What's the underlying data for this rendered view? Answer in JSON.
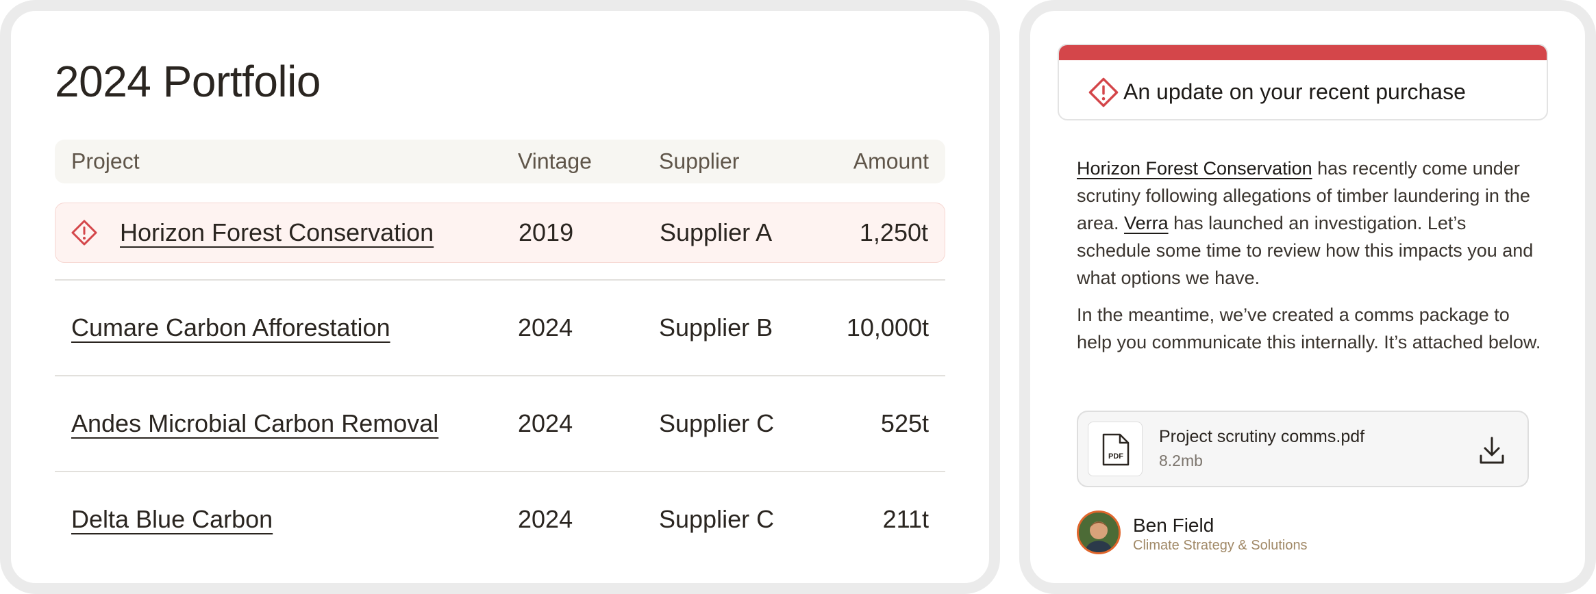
{
  "portfolio": {
    "title": "2024 Portfolio",
    "columns": {
      "project": "Project",
      "vintage": "Vintage",
      "supplier": "Supplier",
      "amount": "Amount"
    },
    "rows": [
      {
        "project": "Horizon Forest Conservation",
        "vintage": "2019",
        "supplier": "Supplier A",
        "amount": "1,250t",
        "alert": true
      },
      {
        "project": "Cumare Carbon Afforestation",
        "vintage": "2024",
        "supplier": "Supplier B",
        "amount": "10,000t",
        "alert": false
      },
      {
        "project": "Andes Microbial Carbon Removal",
        "vintage": "2024",
        "supplier": "Supplier C",
        "amount": "525t",
        "alert": false
      },
      {
        "project": "Delta Blue Carbon",
        "vintage": "2024",
        "supplier": "Supplier C",
        "amount": "211t",
        "alert": false
      }
    ],
    "alert_color": "#d4464a"
  },
  "update": {
    "banner_title": "An update on your recent purchase",
    "banner_color": "#d4464a",
    "message": {
      "p1_link": "Horizon Forest Conservation",
      "p1_text_a": " has recently come under scrutiny following allegations of timber laundering in the area. ",
      "p1_link2": "Verra",
      "p1_text_b": " has launched an investigation. Let’s schedule some time to review how this impacts you and what options we have.",
      "p2": "In the meantime, we’ve created a comms package to help you communicate this internally. It’s attached below."
    },
    "attachment": {
      "name": "Project scrutiny comms.pdf",
      "size": "8.2mb",
      "icon": "pdf-file-icon",
      "icon_label": "PDF",
      "action_icon": "download-icon"
    },
    "sender": {
      "name": "Ben Field",
      "role": "Climate Strategy & Solutions",
      "avatar_border_color": "#e0662c"
    }
  }
}
